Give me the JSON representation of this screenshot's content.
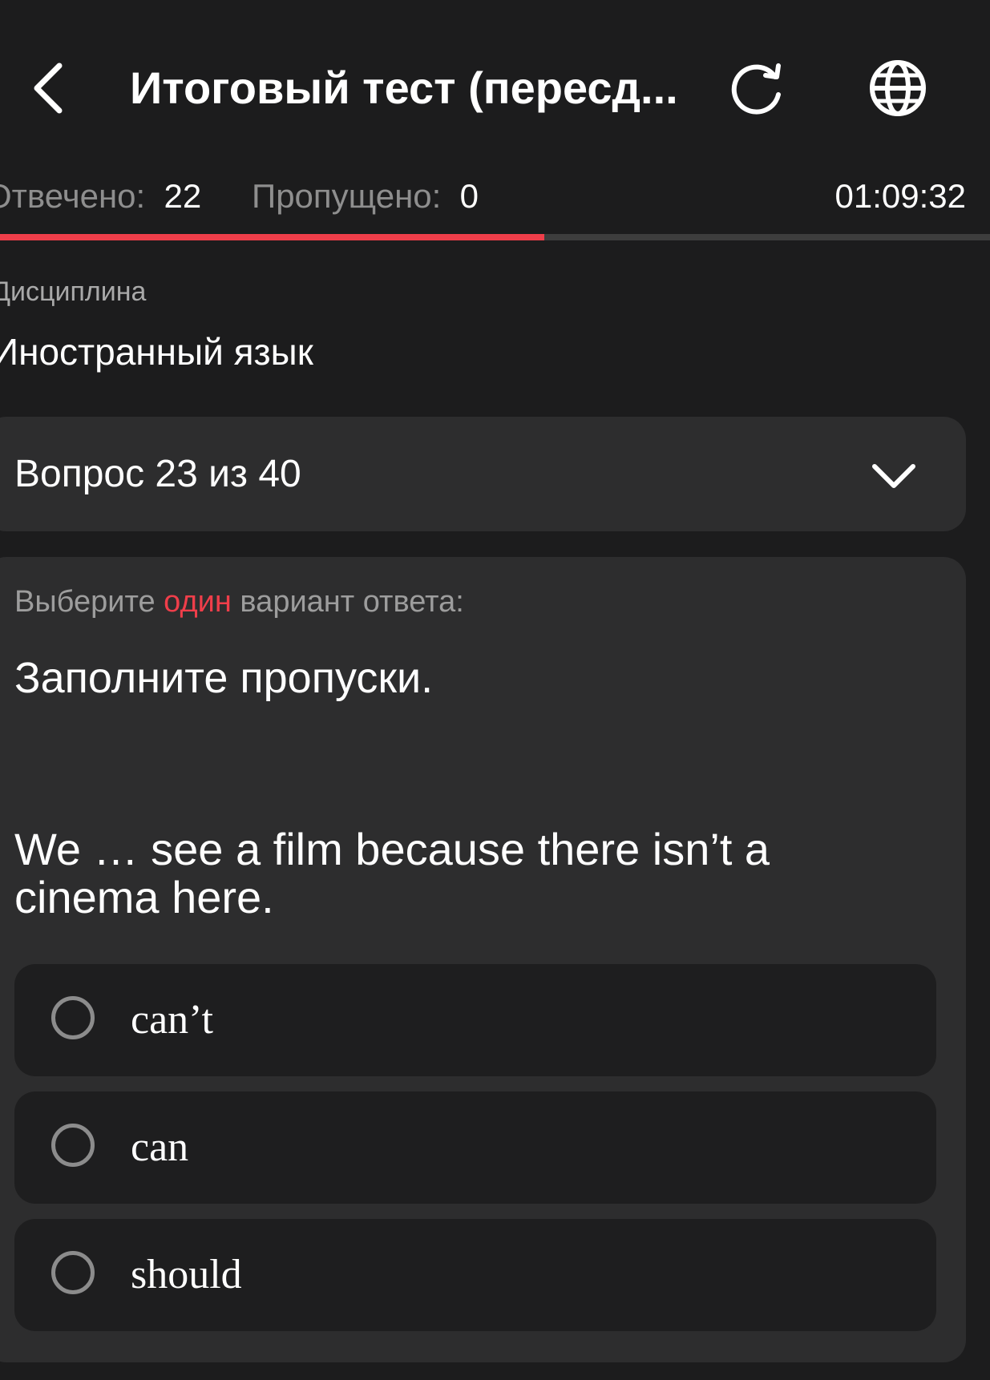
{
  "header": {
    "title": "Итоговый тест (пересд...",
    "back_icon": "chevron-left-icon",
    "reload_icon": "reload-icon",
    "language_icon": "globe-icon"
  },
  "stats": {
    "answered_label": "Отвечено:",
    "answered_value": "22",
    "skipped_label": "Пропущено:",
    "skipped_value": "0",
    "timer": "01:09:32"
  },
  "progress": {
    "fraction": 0.55,
    "accent_color": "#ef3e4a"
  },
  "discipline": {
    "label": "Дисциплина",
    "value": "Иностранный язык"
  },
  "question_selector": {
    "label": "Вопрос 23 из 40",
    "icon": "chevron-down-icon"
  },
  "question": {
    "instruction_prefix": "Выберите",
    "instruction_accent": "один",
    "instruction_suffix": "вариант ответа:",
    "heading": "Заполните пропуски.",
    "text": "We … see a film because there isn’t a cinema here.",
    "options": [
      {
        "label": "can’t",
        "selected": false
      },
      {
        "label": "can",
        "selected": false
      },
      {
        "label": "should",
        "selected": false
      }
    ]
  }
}
